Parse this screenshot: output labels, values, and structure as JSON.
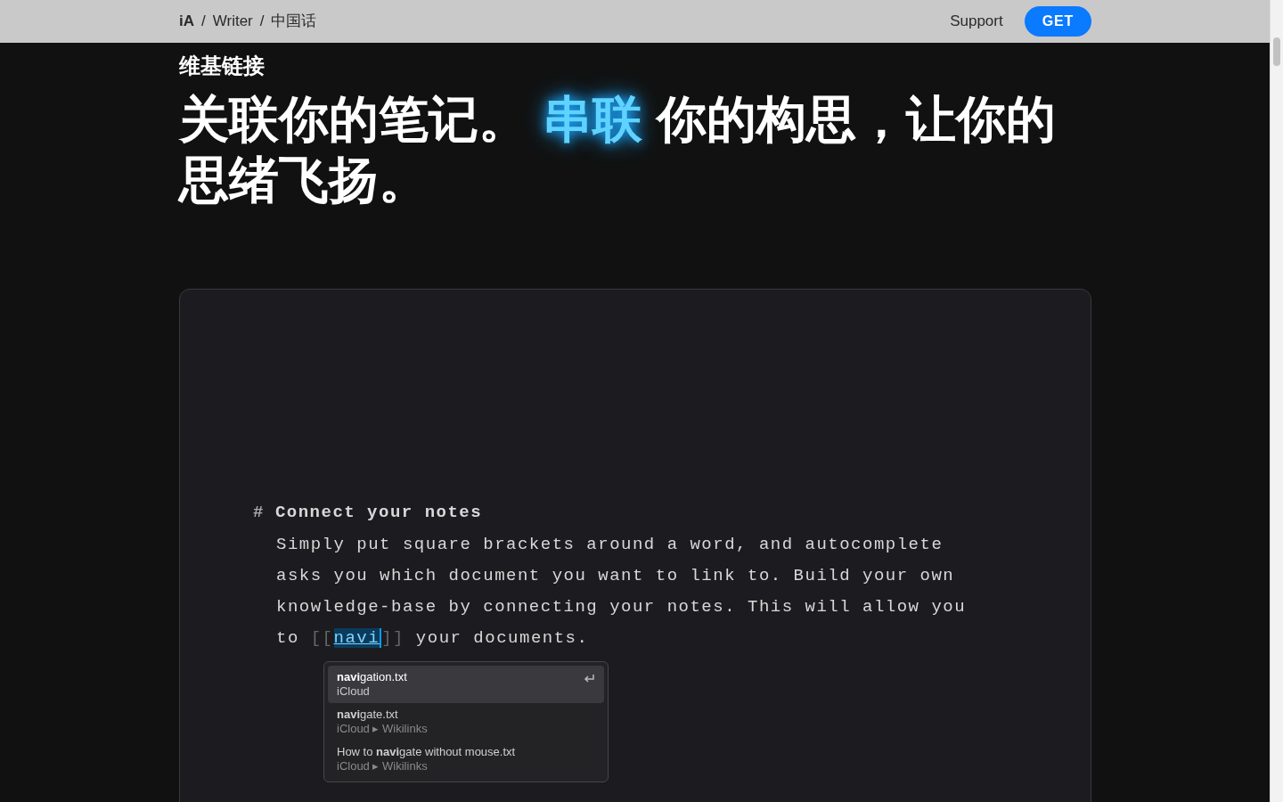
{
  "nav": {
    "breadcrumb": [
      "iA",
      "Writer",
      "中国话"
    ],
    "separator": "/",
    "links": [
      "Support"
    ],
    "cta": "GET"
  },
  "section_label": "维基链接",
  "headline": [
    {
      "text": "关联你的笔记。",
      "highlight": false
    },
    {
      "text": "串联",
      "highlight": true
    },
    {
      "text": "你的构思，让你的思绪飞扬。",
      "highlight": false
    }
  ],
  "editor": {
    "heading_mark": "#",
    "heading": "Connect your notes",
    "body": "Simply put square brackets around a word, and autocomplete asks you which document you want to link to. Build your own knowledge-base by connecting your notes. This will allow you to",
    "link_open": "[[",
    "link_text": "navi",
    "link_close": "]]",
    "after": "your documents.",
    "suggestions": [
      {
        "title": "**navi**gation.txt",
        "path": "iCloud",
        "selected": true
      },
      {
        "title": "**navi**gate.txt",
        "path": "iCloud ▸ Wikilinks",
        "selected": false
      },
      {
        "title": "How to **navi**gate without mouse.txt",
        "path": "iCloud ▸ Wikilinks",
        "selected": false
      }
    ]
  }
}
